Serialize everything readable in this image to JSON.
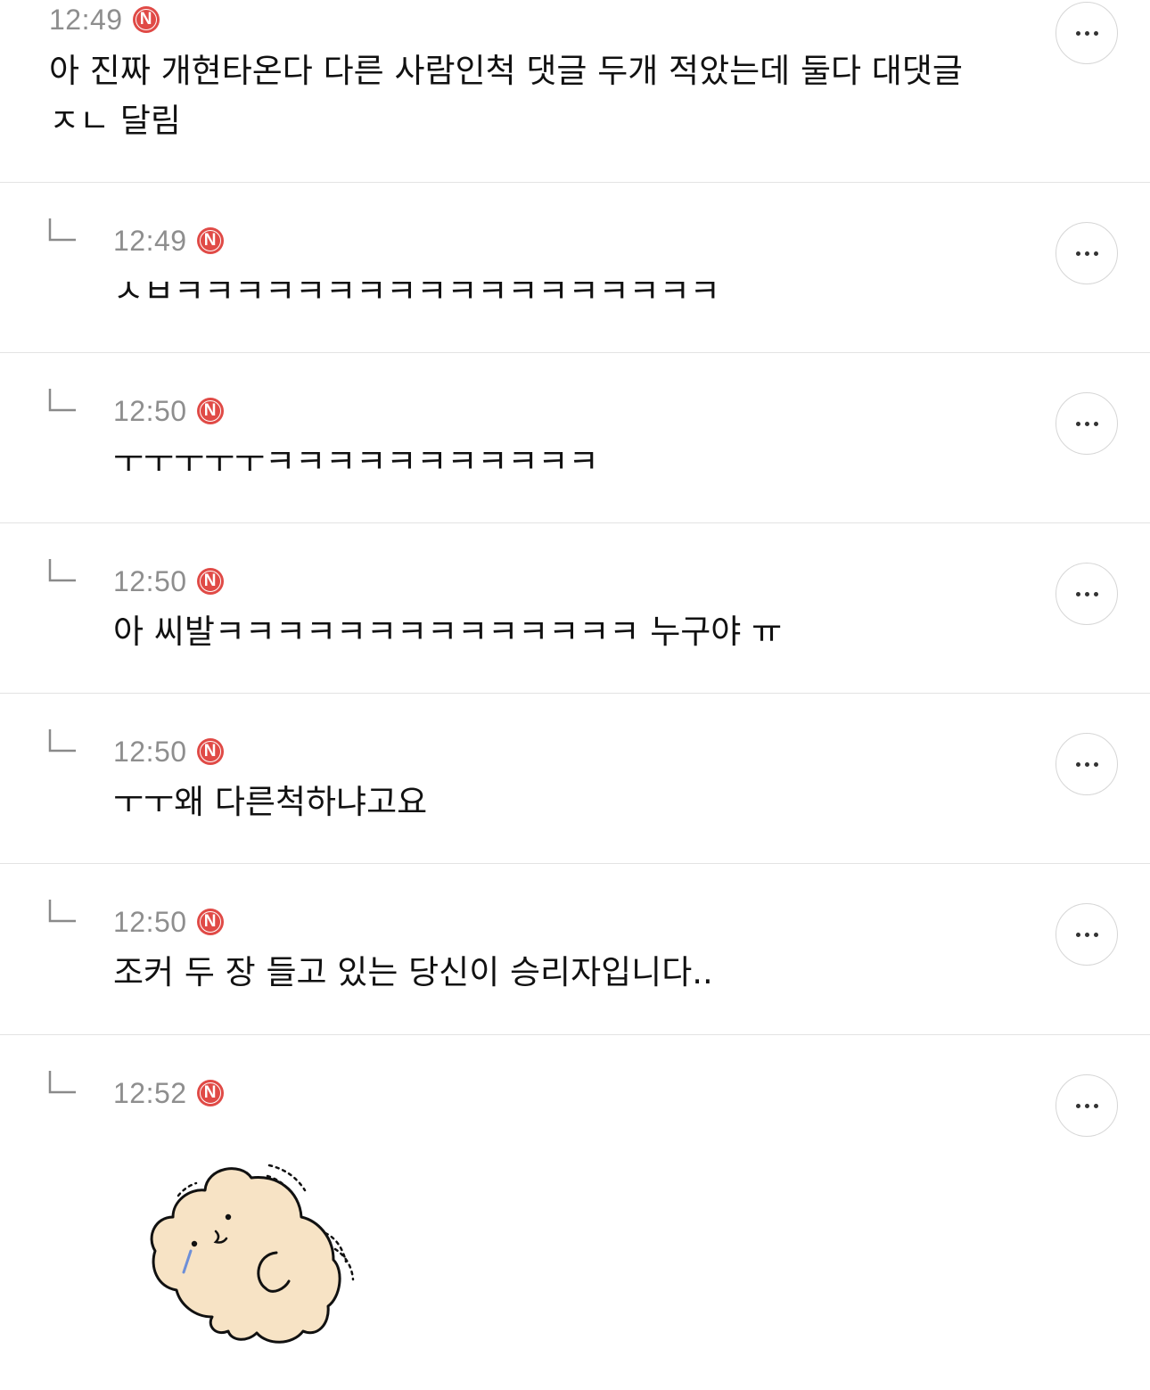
{
  "comments": [
    {
      "time": "12:49",
      "badge": "N",
      "is_reply": false,
      "text": "아 진짜 개현타온다 다른 사람인척 댓글 두개 적았는데 둘다 대댓글 ㅈㄴ 달림"
    },
    {
      "time": "12:49",
      "badge": "N",
      "is_reply": true,
      "text": "ㅅㅂㅋㅋㅋㅋㅋㅋㅋㅋㅋㅋㅋㅋㅋㅋㅋㅋㅋㅋ"
    },
    {
      "time": "12:50",
      "badge": "N",
      "is_reply": true,
      "text": "ㅜㅜㅜㅜㅜㅋㅋㅋㅋㅋㅋㅋㅋㅋㅋㅋ"
    },
    {
      "time": "12:50",
      "badge": "N",
      "is_reply": true,
      "text": "아 씨발ㅋㅋㅋㅋㅋㅋㅋㅋㅋㅋㅋㅋㅋㅋ 누구야 ㅠ"
    },
    {
      "time": "12:50",
      "badge": "N",
      "is_reply": true,
      "text": "ㅜㅜ왜 다른척하냐고요"
    },
    {
      "time": "12:50",
      "badge": "N",
      "is_reply": true,
      "text": "조커 두 장 들고 있는 당신이 승리자입니다.."
    },
    {
      "time": "12:52",
      "badge": "N",
      "is_reply": true,
      "text": "",
      "sticker": "crying-bear-sticker"
    }
  ],
  "icons": {
    "more": "more-options-icon",
    "reply": "reply-arrow-icon",
    "badge": "new-badge-icon"
  },
  "colors": {
    "badge": "#e04a46",
    "time": "#8e8e8e",
    "divider": "#e3e3e3"
  }
}
